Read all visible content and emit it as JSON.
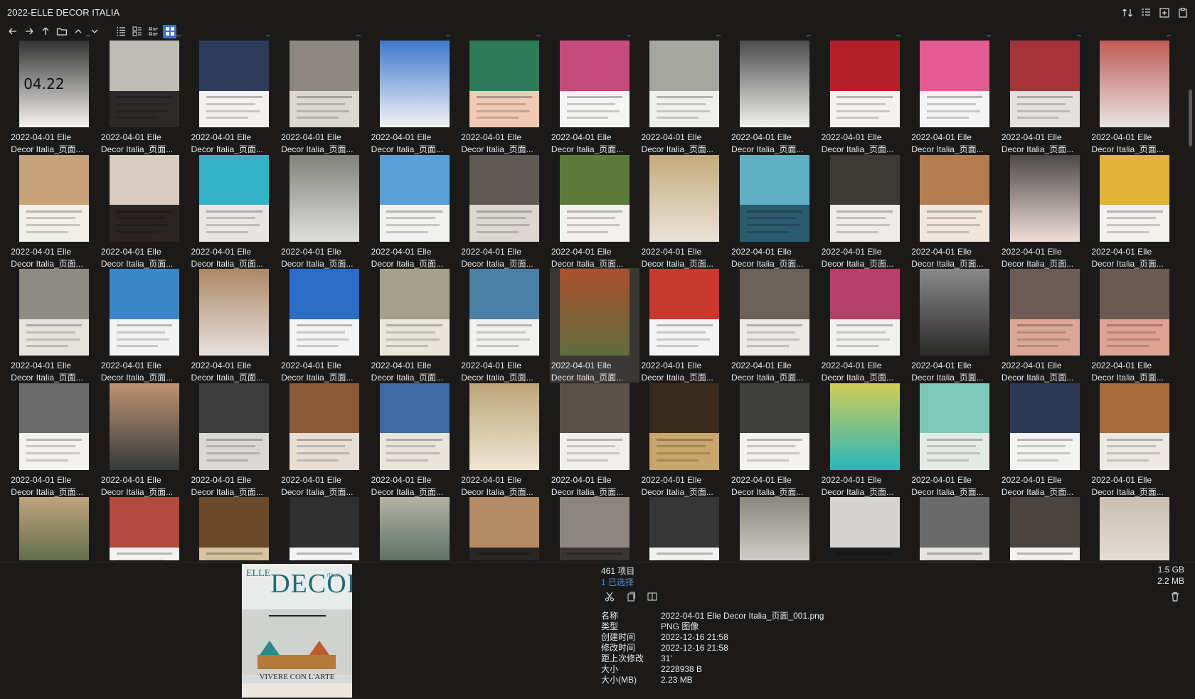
{
  "window": {
    "title": "2022-ELLE DECOR ITALIA"
  },
  "icons": {
    "sort": "sort-icon",
    "details": "details-pane-icon",
    "new_window": "new-window-icon",
    "clipboard": "clipboard-icon",
    "back": "arrow-left-icon",
    "forward": "arrow-right-icon",
    "up": "arrow-up-icon",
    "folder": "folder-icon",
    "chev_up": "chevron-up-icon",
    "chev_down": "chevron-down-icon",
    "view_list": "list-view-icon",
    "view_details": "details-view-icon",
    "view_tiles": "tiles-view-icon",
    "view_thumbs": "thumbnails-view-icon",
    "cut": "cut-icon",
    "copy": "copy-icon",
    "compare": "compare-icon",
    "delete": "trash-icon"
  },
  "grid": {
    "label_line1": "2022-04-01 Elle",
    "label_line2": "Decor Italia_页面...",
    "selected_index": 32,
    "covers": [
      {
        "bg": "#f7f5f2",
        "fg": "#111",
        "text": "04.22"
      },
      {
        "bg": "#2c2b2a",
        "fg": "#bfbcb5",
        "text": ""
      },
      {
        "bg": "#f2f1ee",
        "fg": "#2d3b5a",
        "text": ""
      },
      {
        "bg": "#dcd8d2",
        "fg": "#8c8780",
        "text": ""
      },
      {
        "bg": "#f3f3f3",
        "fg": "#1e63c7",
        "text": ""
      },
      {
        "bg": "#f1c9b5",
        "fg": "#2d7a59",
        "text": ""
      },
      {
        "bg": "#f5f5f3",
        "fg": "#c44b7b",
        "text": ""
      },
      {
        "bg": "#efefed",
        "fg": "#a6a6a0",
        "text": ""
      },
      {
        "bg": "#f2f2f0",
        "fg": "#2e2e2e",
        "text": ""
      },
      {
        "bg": "#f4f2ef",
        "fg": "#b51f2b",
        "text": ""
      },
      {
        "bg": "#f4f4f4",
        "fg": "#e15b90",
        "text": ""
      },
      {
        "bg": "#e4e1de",
        "fg": "#a8323a",
        "text": ""
      },
      {
        "bg": "#e8e6e2",
        "fg": "#b8423c",
        "text": ""
      },
      {
        "bg": "#f1efe9",
        "fg": "#c6a37a",
        "text": ""
      },
      {
        "bg": "#2b2521",
        "fg": "#d8ccc1",
        "text": ""
      },
      {
        "bg": "#e8e6e2",
        "fg": "#36b1c6",
        "text": ""
      },
      {
        "bg": "#dfe0dc",
        "fg": "#72716b",
        "text": ""
      },
      {
        "bg": "#f1f1ef",
        "fg": "#5aa0d6",
        "text": ""
      },
      {
        "bg": "#dcd8d1",
        "fg": "#5f5a53",
        "text": ""
      },
      {
        "bg": "#f3f1ed",
        "fg": "#5c7a3a",
        "text": ""
      },
      {
        "bg": "#e9e3d9",
        "fg": "#bfa16a",
        "text": ""
      },
      {
        "bg": "#2a5b6e",
        "fg": "#5fb0c5",
        "text": ""
      },
      {
        "bg": "#eeece8",
        "fg": "#3d3a36",
        "text": ""
      },
      {
        "bg": "#efe6dc",
        "fg": "#b57d4f",
        "text": ""
      },
      {
        "bg": "#f0ddd9",
        "fg": "#2f2f2f",
        "text": ""
      },
      {
        "bg": "#f2f1ec",
        "fg": "#e2b338",
        "text": ""
      },
      {
        "bg": "#e6e4df",
        "fg": "#8e8a84",
        "text": ""
      },
      {
        "bg": "#f3f3f3",
        "fg": "#3b86c9",
        "text": ""
      },
      {
        "bg": "#e6e2dd",
        "fg": "#a3774f",
        "text": ""
      },
      {
        "bg": "#f4f4f4",
        "fg": "#2b6cc6",
        "text": ""
      },
      {
        "bg": "#eae6dc",
        "fg": "#a4a18b",
        "text": ""
      },
      {
        "bg": "#f1f1ee",
        "fg": "#4b7fa4",
        "text": ""
      },
      {
        "bg": "#5e6c3c",
        "fg": "#b74b2b",
        "text": ""
      },
      {
        "bg": "#f4f4f4",
        "fg": "#c7392f",
        "text": ""
      },
      {
        "bg": "#ece9e5",
        "fg": "#6b6158",
        "text": ""
      },
      {
        "bg": "#f1f1ef",
        "fg": "#b63f6a",
        "text": ""
      },
      {
        "bg": "#2a2928",
        "fg": "#9b9a99",
        "text": ""
      },
      {
        "bg": "#dca799",
        "fg": "#6d5b55",
        "text": ""
      },
      {
        "bg": "#e0a294",
        "fg": "#6b5952",
        "text": ""
      },
      {
        "bg": "#f3f2ee",
        "fg": "#6b6b6b",
        "text": ""
      },
      {
        "bg": "#353a3c",
        "fg": "#d8a37a",
        "text": ""
      },
      {
        "bg": "#dad8d4",
        "fg": "#3d3d3d",
        "text": ""
      },
      {
        "bg": "#e7dfd5",
        "fg": "#8b5b39",
        "text": ""
      },
      {
        "bg": "#e9e4dc",
        "fg": "#3c6aa3",
        "text": ""
      },
      {
        "bg": "#efe6d3",
        "fg": "#b59a69",
        "text": ""
      },
      {
        "bg": "#f1efec",
        "fg": "#5a5148",
        "text": ""
      },
      {
        "bg": "#c9a66c",
        "fg": "#3a2c1c",
        "text": ""
      },
      {
        "bg": "#f3f2ef",
        "fg": "#40403d",
        "text": ""
      },
      {
        "bg": "#27b7b8",
        "fg": "#f2d046",
        "text": ""
      },
      {
        "bg": "#e4ebe7",
        "fg": "#7fc7b6",
        "text": ""
      },
      {
        "bg": "#f3f3f1",
        "fg": "#2c3a56",
        "text": ""
      },
      {
        "bg": "#ede8e1",
        "fg": "#a86b3d",
        "text": ""
      },
      {
        "bg": "#3f5a3a",
        "fg": "#d7b08b",
        "text": ""
      },
      {
        "bg": "#f3f3f2",
        "fg": "#b34a3d",
        "text": ""
      },
      {
        "bg": "#d7c39f",
        "fg": "#6a4a2b",
        "text": ""
      },
      {
        "bg": "#f3f3f3",
        "fg": "#2f2f2f",
        "text": ""
      },
      {
        "bg": "#3e5a4c",
        "fg": "#c9c2b6",
        "text": ""
      },
      {
        "bg": "#2a2624",
        "fg": "#b48b66",
        "text": ""
      },
      {
        "bg": "#3a3533",
        "fg": "#8c8580",
        "text": ""
      },
      {
        "bg": "#f2f2f1",
        "fg": "#363636",
        "text": ""
      },
      {
        "bg": "#e8e6e3",
        "fg": "#7b756e",
        "text": ""
      },
      {
        "bg": "#1b1b1b",
        "fg": "#d5d3d0",
        "text": ""
      },
      {
        "bg": "#e5e3e0",
        "fg": "#6a6a6a",
        "text": ""
      },
      {
        "bg": "#f2f1ef",
        "fg": "#4a4440",
        "text": ""
      },
      {
        "bg": "#eee9e2",
        "fg": "#c4b7a8",
        "text": ""
      }
    ]
  },
  "preview": {
    "logo": "DECOR",
    "logo_prefix": "ELLE",
    "country": "ITALIA",
    "caption": "VIVERE CON L'ARTE"
  },
  "info": {
    "item_count": "461 项目",
    "selected_count": "1 已选择",
    "total_size": "1.5 GB",
    "selected_size": "2.2 MB",
    "props": [
      {
        "label": "名称",
        "value": "2022-04-01 Elle Decor Italia_页面_001.png"
      },
      {
        "label": "类型",
        "value": "PNG 图像"
      },
      {
        "label": "创建时间",
        "value": "2022-12-16  21:58"
      },
      {
        "label": "修改时间",
        "value": "2022-12-16  21:58"
      },
      {
        "label": "距上次修改",
        "value": "31'"
      },
      {
        "label": "大小",
        "value": "2228938 B"
      },
      {
        "label": "大小(MB)",
        "value": "2.23 MB"
      }
    ]
  },
  "colors": {
    "background": "#1b1a19",
    "accent": "#3d6fd3",
    "link": "#4a90e2",
    "selected": "#3a3836"
  }
}
